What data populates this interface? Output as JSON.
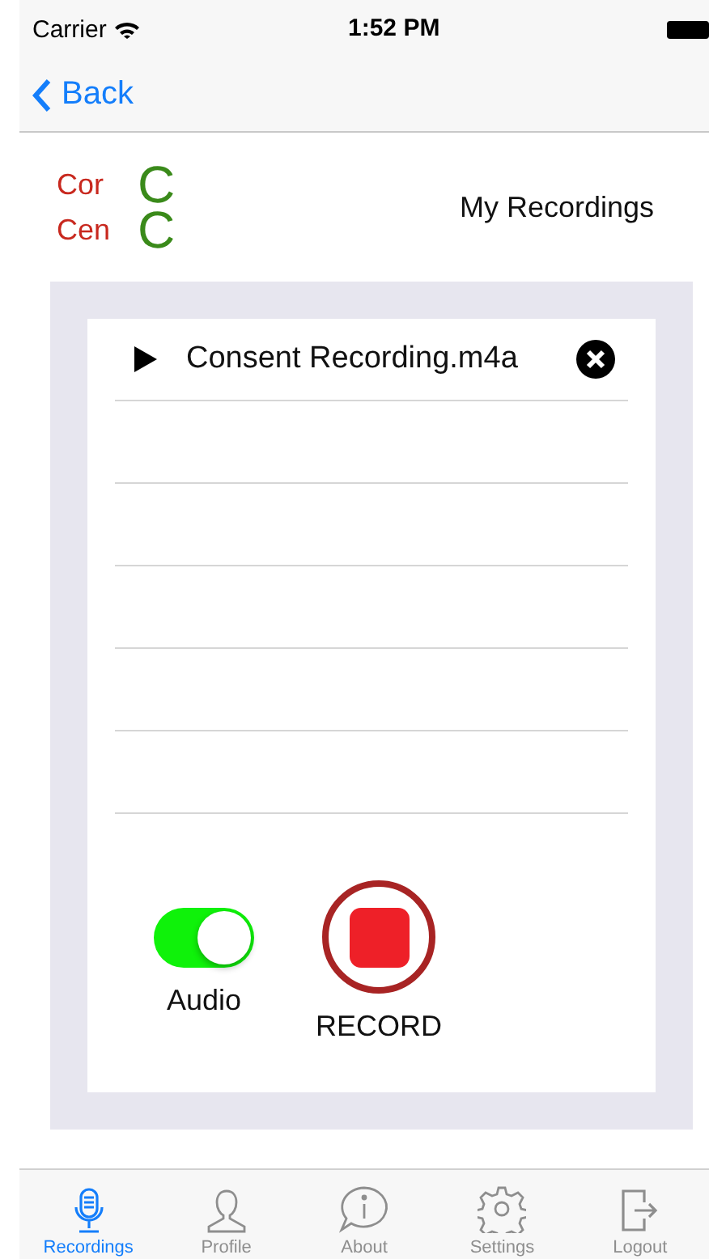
{
  "status_bar": {
    "carrier": "Carrier",
    "time": "1:52 PM"
  },
  "nav": {
    "back": "Back"
  },
  "logo": [
    {
      "text": "Cor",
      "color": "#c8281e"
    },
    {
      "text": "Cen",
      "color": "#c8281e"
    },
    {
      "text": "C",
      "color": "#3a8a1a"
    },
    {
      "text": "C",
      "color": "#3a8a1a"
    }
  ],
  "title": "My Recordings",
  "recordings": [
    {
      "name": "Consent Recording.m4a"
    }
  ],
  "audio": {
    "label": "Audio",
    "on": true
  },
  "record": {
    "label": "RECORD"
  },
  "tabs": [
    {
      "label": "Recordings",
      "kind": "mic",
      "selected": true
    },
    {
      "label": "Profile",
      "kind": "profile",
      "selected": false
    },
    {
      "label": "About",
      "kind": "about",
      "selected": false
    },
    {
      "label": "Settings",
      "kind": "settings",
      "selected": false
    },
    {
      "label": "Logout",
      "kind": "logout",
      "selected": false
    }
  ]
}
